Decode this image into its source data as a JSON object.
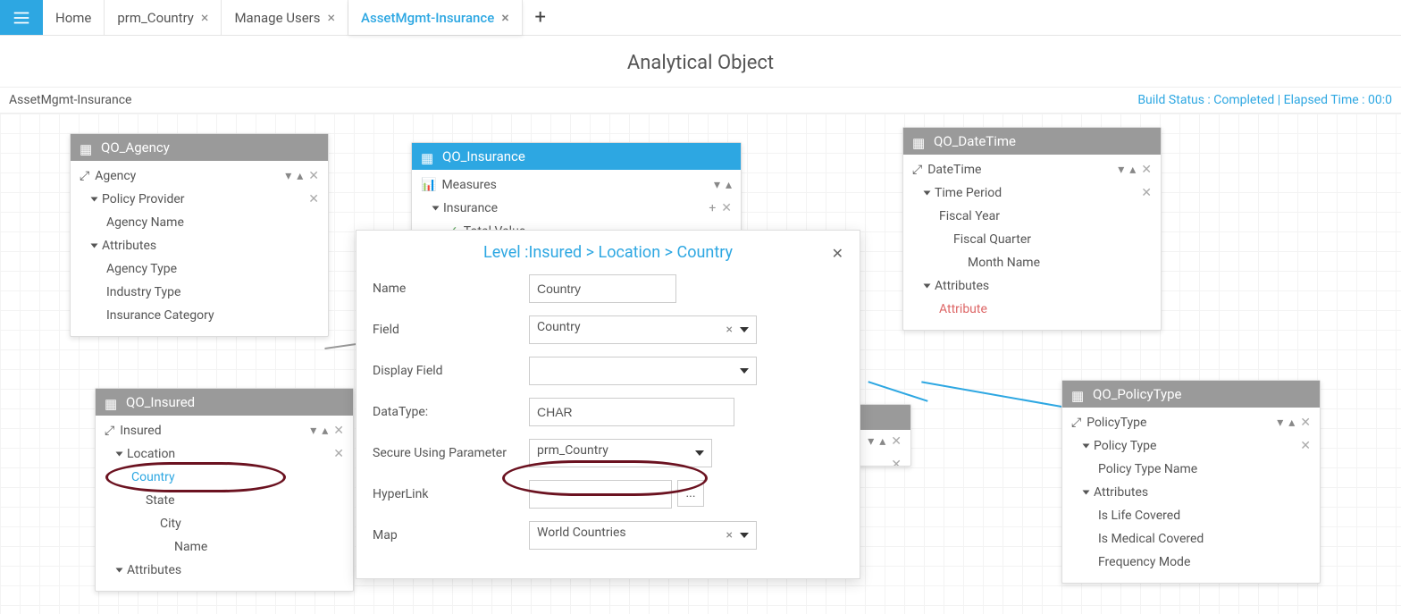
{
  "tabs": {
    "home": "Home",
    "items": [
      {
        "label": "prm_Country"
      },
      {
        "label": "Manage Users"
      },
      {
        "label": "AssetMgmt-Insurance",
        "active": true
      }
    ]
  },
  "pageTitle": "Analytical Object",
  "status": {
    "left": "AssetMgmt-Insurance",
    "right": "Build Status : Completed | Elapsed Time : 00:0"
  },
  "panels": {
    "agency": {
      "title": "QO_Agency",
      "dim": "Agency",
      "group1": "Policy Provider",
      "item1": "Agency Name",
      "group2": "Attributes",
      "attrs": [
        "Agency Type",
        "Industry Type",
        "Insurance Category"
      ]
    },
    "insurance": {
      "title": "QO_Insurance",
      "dim": "Measures",
      "group": "Insurance",
      "item": "Total Value"
    },
    "datetime": {
      "title": "QO_DateTime",
      "dim": "DateTime",
      "group1": "Time Period",
      "items": [
        "Fiscal Year",
        "Fiscal Quarter",
        "Month Name"
      ],
      "group2": "Attributes",
      "attrLabel": "Attribute"
    },
    "insured": {
      "title": "QO_Insured",
      "dim": "Insured",
      "group1": "Location",
      "items": [
        "Country",
        "State",
        "City",
        "Name"
      ],
      "group2": "Attributes"
    },
    "policytype": {
      "title": "QO_PolicyType",
      "dim": "PolicyType",
      "group1": "Policy Type",
      "item1": "Policy Type Name",
      "group2": "Attributes",
      "attrs": [
        "Is Life Covered",
        "Is Medical Covered",
        "Frequency Mode"
      ]
    }
  },
  "dialog": {
    "title": "Level :Insured > Location > Country",
    "labels": {
      "name": "Name",
      "field": "Field",
      "displayField": "Display Field",
      "datatype": "DataType:",
      "secureParam": "Secure Using Parameter",
      "hyperlink": "HyperLink",
      "map": "Map"
    },
    "values": {
      "name": "Country",
      "field": "Country",
      "displayField": "",
      "datatype": "CHAR",
      "secureParam": "prm_Country",
      "hyperlink": "",
      "map": "World Countries"
    },
    "browse": "..."
  }
}
